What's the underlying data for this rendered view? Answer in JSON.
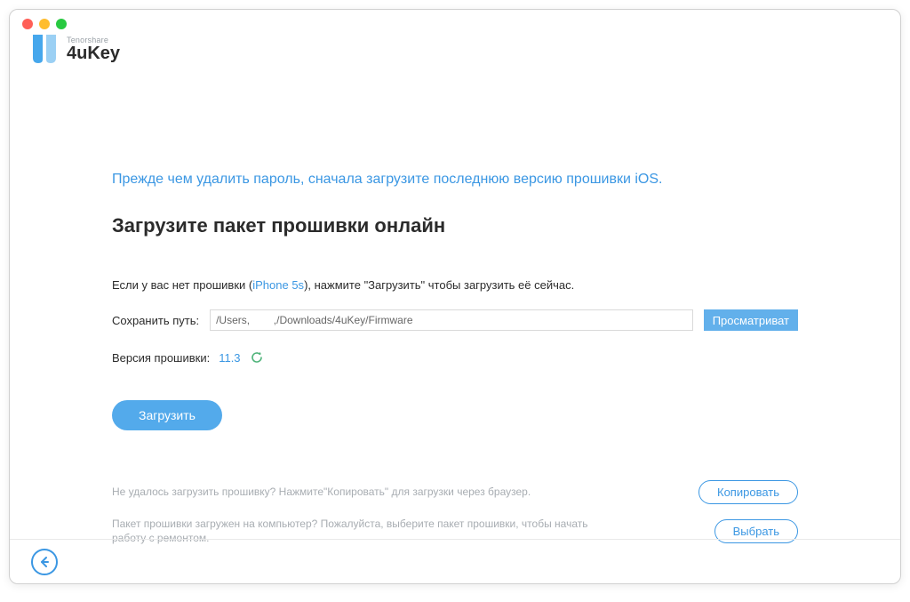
{
  "brand": {
    "company": "Tenorshare",
    "product": "4uKey"
  },
  "info_line": "Прежде чем удалить пароль, сначала загрузите последнюю версию прошивки iOS.",
  "section_title": "Загрузите пакет прошивки онлайн",
  "hint": {
    "prefix": "Если у вас нет прошивки (",
    "device": "iPhone 5s",
    "suffix": "), нажмите \"Загрузить\" чтобы загрузить её сейчас."
  },
  "path": {
    "label": "Сохранить путь:",
    "value": "/Users,        ,/Downloads/4uKey/Firmware",
    "browse_label": "Просматриват"
  },
  "version": {
    "label": "Версия прошивки:",
    "value": "11.3"
  },
  "download_label": "Загрузить",
  "footer": {
    "copy_text": "Не удалось загрузить прошивку? Нажмите\"Копировать\" для загрузки через браузер.",
    "copy_label": "Копировать",
    "select_text": "Пакет прошивки загружен на компьютер? Пожалуйста, выберите пакет прошивки, чтобы начать работу с ремонтом.",
    "select_label": "Выбрать"
  }
}
